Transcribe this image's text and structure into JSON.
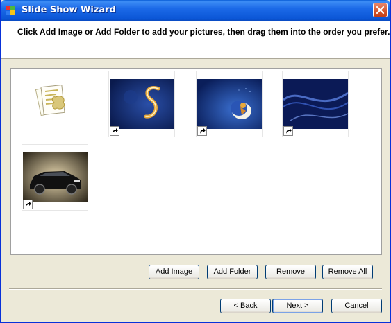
{
  "window": {
    "title": "Slide Show Wizard"
  },
  "header": {
    "instruction": "Click Add Image or Add Folder to add your pictures, then drag them into the order you prefer."
  },
  "thumbnails": [
    {
      "name": "document-icon-thumbnail",
      "kind": "document",
      "shortcut": false
    },
    {
      "name": "golden-s-image",
      "kind": "blue-swirl",
      "shortcut": true
    },
    {
      "name": "moon-figure-image",
      "kind": "moon",
      "shortcut": true
    },
    {
      "name": "blue-waves-image",
      "kind": "waves",
      "shortcut": true
    },
    {
      "name": "black-car-image",
      "kind": "car",
      "shortcut": true
    }
  ],
  "actions": {
    "add_image": "Add Image",
    "add_folder": "Add Folder",
    "remove": "Remove",
    "remove_all": "Remove All"
  },
  "footer": {
    "back": "< Back",
    "next": "Next >",
    "cancel": "Cancel"
  },
  "colors": {
    "titlebar": "#0b56d6",
    "dialog_bg": "#ece9d8",
    "button_border": "#003c74"
  }
}
